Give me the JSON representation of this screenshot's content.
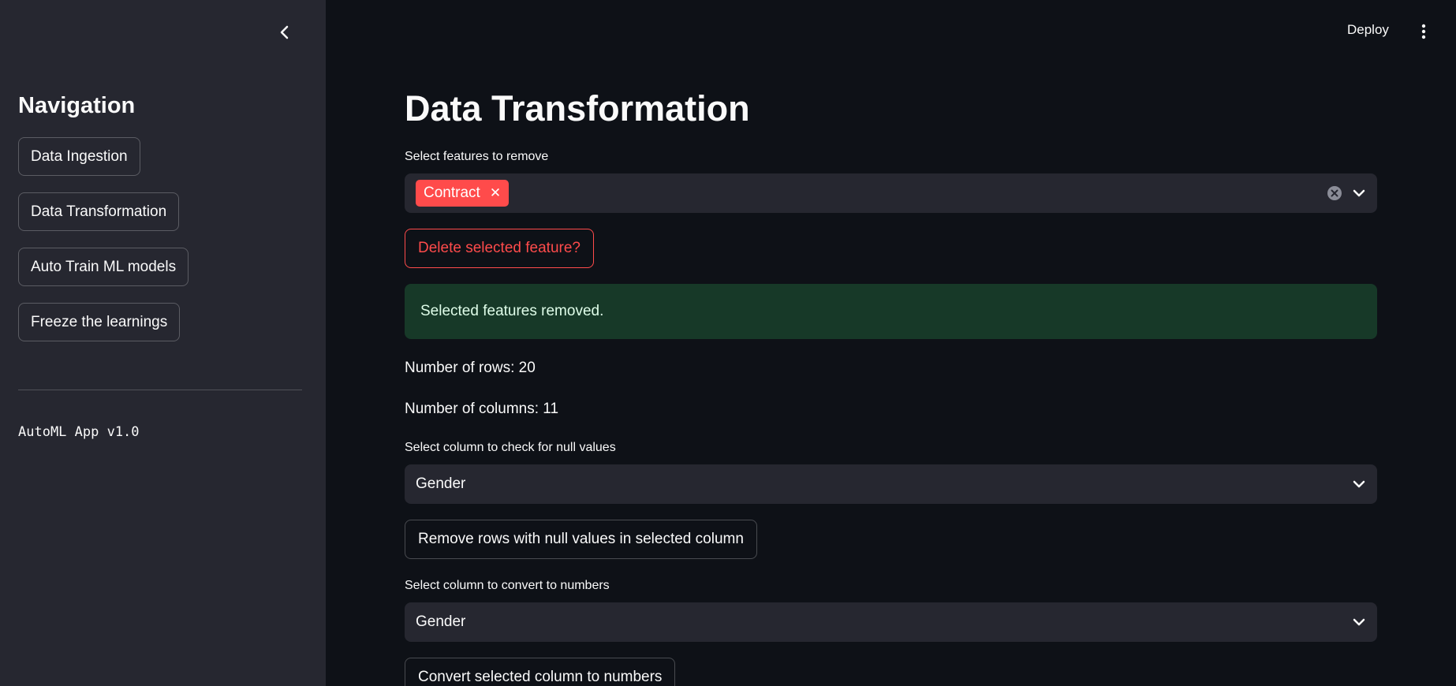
{
  "sidebar": {
    "title": "Navigation",
    "items": [
      {
        "label": "Data Ingestion"
      },
      {
        "label": "Data Transformation"
      },
      {
        "label": "Auto Train ML models"
      },
      {
        "label": "Freeze the learnings"
      }
    ],
    "version": "AutoML App v1.0"
  },
  "header": {
    "deploy_label": "Deploy"
  },
  "main": {
    "title": "Data Transformation",
    "remove_features": {
      "label": "Select features to remove",
      "selected_tags": [
        "Contract"
      ]
    },
    "delete_button_label": "Delete selected feature?",
    "success_message": "Selected features removed.",
    "rows_text": "Number of rows: 20",
    "columns_text": "Number of columns: 11",
    "null_check": {
      "label": "Select column to check for null values",
      "value": "Gender",
      "button_label": "Remove rows with null values in selected column"
    },
    "convert": {
      "label": "Select column to convert to numbers",
      "value": "Gender",
      "button_label": "Convert selected column to numbers"
    }
  },
  "colors": {
    "background": "#0e1117",
    "sidebar": "#262730",
    "accent": "#ff4b4b",
    "success_bg": "#173928"
  },
  "icons": {
    "collapse": "chevron-left-icon",
    "menu": "kebab-menu-icon",
    "dropdown": "chevron-down-icon",
    "clear": "clear-circle-icon",
    "tag_remove": "close-icon"
  }
}
